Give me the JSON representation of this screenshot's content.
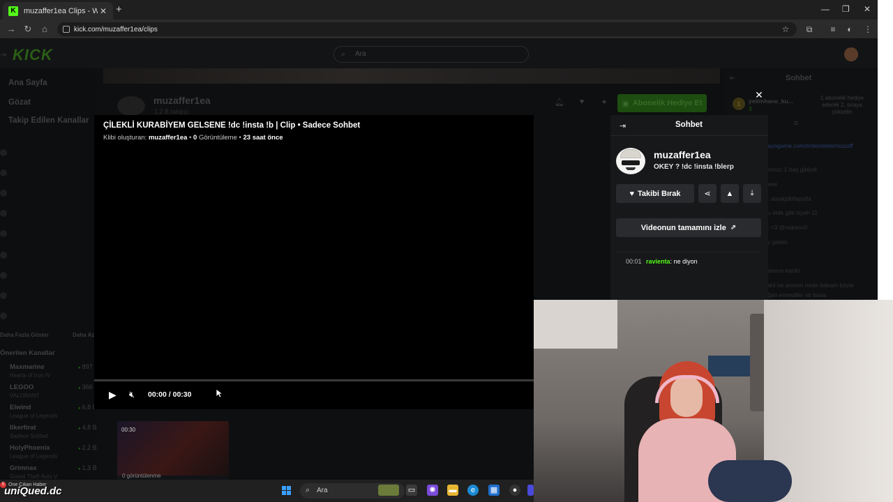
{
  "browser": {
    "tab_title": "muzaffer1ea Clips - Watch Live",
    "tab_favicon": "K",
    "url": "kick.com/muzaffer1ea/clips"
  },
  "site": {
    "logo": "KICK",
    "search_placeholder": "Ara",
    "nav": {
      "home": "Ana Sayfa",
      "browse": "Gözat",
      "following": "Takip Edilen Kanallar",
      "show_more": "Daha Fazla Göster",
      "show_less": "Daha Az",
      "recommended": "Önerilen Kanallar"
    },
    "recommended_channels": [
      {
        "name": "Maxmarine",
        "category": "Hearts of Iron IV",
        "viewers": "897"
      },
      {
        "name": "LEGOO",
        "category": "VALORANT",
        "viewers": "366"
      },
      {
        "name": "Elwind",
        "category": "League of Legends",
        "viewers": "6,8 B"
      },
      {
        "name": "Ilkerfirat",
        "category": "Sadece Sohbet",
        "viewers": "4,8 B"
      },
      {
        "name": "HolyPhoenix",
        "category": "League of Legends",
        "viewers": "2,2 B"
      },
      {
        "name": "Grimnax",
        "category": "Grand Theft Auto V",
        "viewers": "1,3 B"
      }
    ],
    "channel": {
      "name": "muzaffer1ea",
      "followers": "1,2 B takipçi",
      "gift_sub_button": "Abonelik Hediye Et"
    },
    "background_chat": {
      "title": "Sohbet",
      "promo_user": "yetimhane_ku...",
      "promo_count": "3",
      "promo_text": "1 abonelik hediye ederek 2. sıraya yükselin",
      "lines": [
        "ayogame.com/tr/destekle/muzaff",
        "ırmızı 1 baş gibiydi",
        "eee",
        ": alaskjdbflajsdfa",
        "u elde gitti siyah 11",
        ": <3 @saksoo0",
        "y gelsin",
        "amsın kardo",
        "ahl ne annem nede babam böyle",
        "ğan etmediler vb bana"
      ]
    }
  },
  "clip": {
    "title": "ÇİLEKLİ KURABİYEM GELSENE !dc !insta !b | Clip • Sadece Sohbet",
    "meta_prefix": "Klibi oluşturan:",
    "creator": "muzaffer1ea",
    "views_count": "0",
    "views_label": "Görüntüleme",
    "age": "23 saat önce",
    "player": {
      "time": "00:00 / 00:30",
      "progress": 0.0
    },
    "more_clip": {
      "duration": "00:30",
      "views": "0 görüntülenme"
    },
    "panel": {
      "title": "Sohbet",
      "streamer_name": "muzaffer1ea",
      "stream_status": "OKEY ?  !dc !insta !blerp",
      "unfollow_button": "Takibi Bırak",
      "watch_full_button": "Videonun tamamını izle",
      "chat": [
        {
          "time": "00:01",
          "user": "ravienta",
          "message": "ne diyon"
        }
      ]
    }
  },
  "overlay": {
    "brand_tag": "uniQued.dc",
    "notif_count": "5",
    "ticker": "One Çıkan Haber"
  },
  "taskbar": {
    "search_placeholder": "Ara"
  },
  "colors": {
    "kick_green": "#53fc18",
    "panel_bg": "#17181a",
    "button_bg": "#2a2b2e"
  }
}
